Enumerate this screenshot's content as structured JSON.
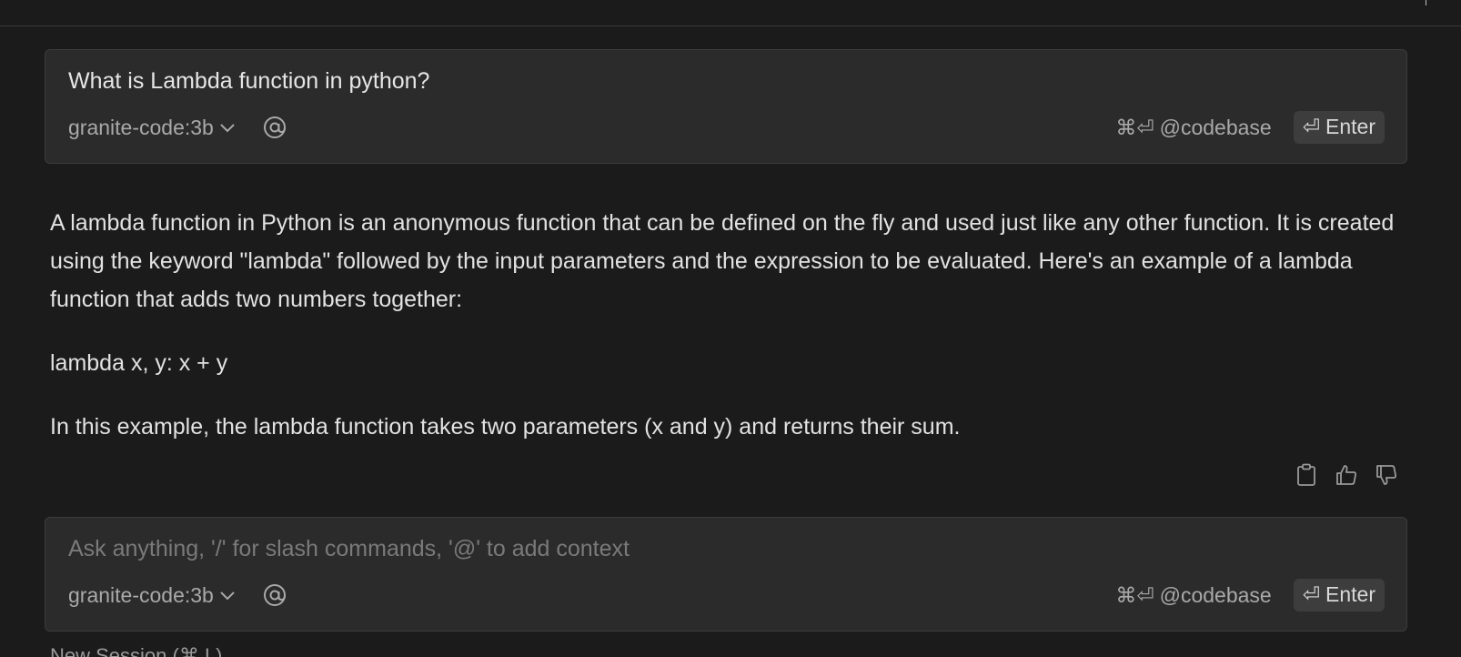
{
  "first_input": {
    "text": "What is Lambda function in python?",
    "model": "granite-code:3b",
    "codebase_shortcut": "⌘⏎",
    "codebase_label": "@codebase",
    "enter_symbol": "⏎",
    "enter_label": "Enter"
  },
  "response": {
    "paragraph_1": "A lambda function in Python is an anonymous function that can be defined on the fly and used just like any other function. It is created using the keyword \"lambda\" followed by the input parameters and the expression to be evaluated. Here's an example of a lambda function that adds two numbers together:",
    "code": "lambda x, y: x + y",
    "paragraph_2": "In this example, the lambda function takes two parameters (x and y) and returns their sum.",
    "actions": [
      "clipboard-icon",
      "thumbs-up-icon",
      "thumbs-down-icon"
    ]
  },
  "second_input": {
    "placeholder": "Ask anything, '/' for slash commands, '@' to add context",
    "model": "granite-code:3b",
    "codebase_shortcut": "⌘⏎",
    "codebase_label": "@codebase",
    "enter_symbol": "⏎",
    "enter_label": "Enter"
  },
  "new_session_label": "New Session (⌘ L)",
  "colors": {
    "background": "#1b1b1b",
    "input_background": "#2b2b2b",
    "enter_button": "#3d3d3d",
    "text": "#e2e2e2",
    "muted_text": "#a9a9a9"
  }
}
